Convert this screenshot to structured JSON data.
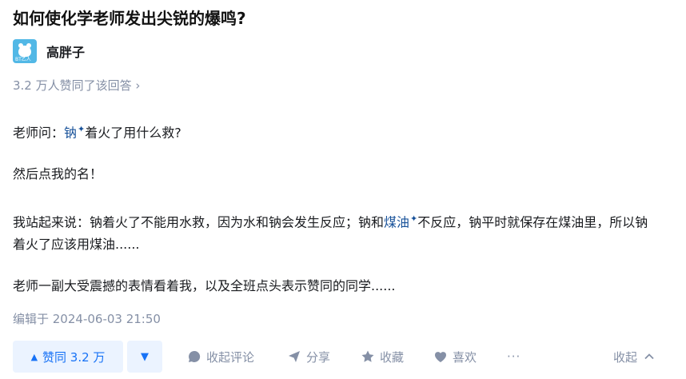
{
  "question": {
    "title": "如何使化学老师发出尖锐的爆鸣?"
  },
  "author": {
    "name": "高胖子",
    "avatar_icon": "bear-avatar-icon",
    "avatar_tag": "BT乙人"
  },
  "meta": {
    "votes_text": "3.2 万人赞同了该回答",
    "votes_chevron": "›"
  },
  "content": {
    "p1_before": "老师问：",
    "p1_link": "钠",
    "p1_after": "着火了用什么救?",
    "p2": "然后点我的名！",
    "p3_before": "我站起来说：钠着火了不能用水救，因为水和钠会发生反应；钠和",
    "p3_link": "煤油",
    "p3_after": "不反应，钠平时就保存在煤油里，所以钠着火了应该用煤油......",
    "p4": "老师一副大受震撼的表情看着我，以及全班点头表示赞同的同学......",
    "link_mark": "✦"
  },
  "edited": "编辑于 2024-06-03 21:50",
  "actions": {
    "upvote_icon": "▲",
    "upvote_label": "赞同 3.2 万",
    "downvote_icon": "▼",
    "comment_label": "收起评论",
    "share_label": "分享",
    "favorite_label": "收藏",
    "like_label": "喜欢",
    "more_label": "···",
    "collapse_label": "收起"
  },
  "colors": {
    "accent": "#1772f6",
    "accent_bg": "#ebf3ff",
    "muted": "#8590a6",
    "link": "#175199"
  }
}
